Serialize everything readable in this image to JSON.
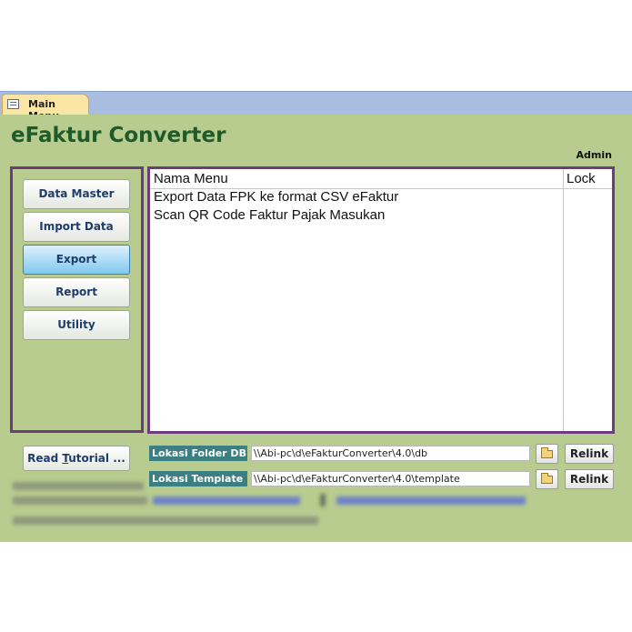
{
  "tab": {
    "label": "Main Menu"
  },
  "header": {
    "title": "eFaktur Converter",
    "user": "Admin"
  },
  "sidebar": {
    "items": [
      {
        "label": "Data Master",
        "active": false
      },
      {
        "label": "Import Data",
        "active": false
      },
      {
        "label": "Export",
        "active": true
      },
      {
        "label": "Report",
        "active": false
      },
      {
        "label": "Utility",
        "active": false
      }
    ]
  },
  "menu_list": {
    "columns": [
      "Nama Menu",
      "Lock"
    ],
    "rows": [
      {
        "name": "Export Data FPK ke format CSV eFaktur",
        "lock": ""
      },
      {
        "name": "Scan QR Code Faktur Pajak Masukan",
        "lock": ""
      }
    ]
  },
  "tutorial_button": {
    "prefix": "Read ",
    "accel": "T",
    "rest": "utorial ..."
  },
  "paths": {
    "db": {
      "label": "Lokasi Folder DB",
      "value": "\\\\Abi-pc\\d\\eFakturConverter\\4.0\\db",
      "relink": "Relink"
    },
    "template": {
      "label": "Lokasi Template",
      "value": "\\\\Abi-pc\\d\\eFakturConverter\\4.0\\template",
      "relink": "Relink"
    }
  },
  "colors": {
    "form_bg": "#b8cc8f",
    "title": "#1f5a2a",
    "panel_border": "#6b3d80",
    "path_label_bg": "#3c7f82"
  }
}
